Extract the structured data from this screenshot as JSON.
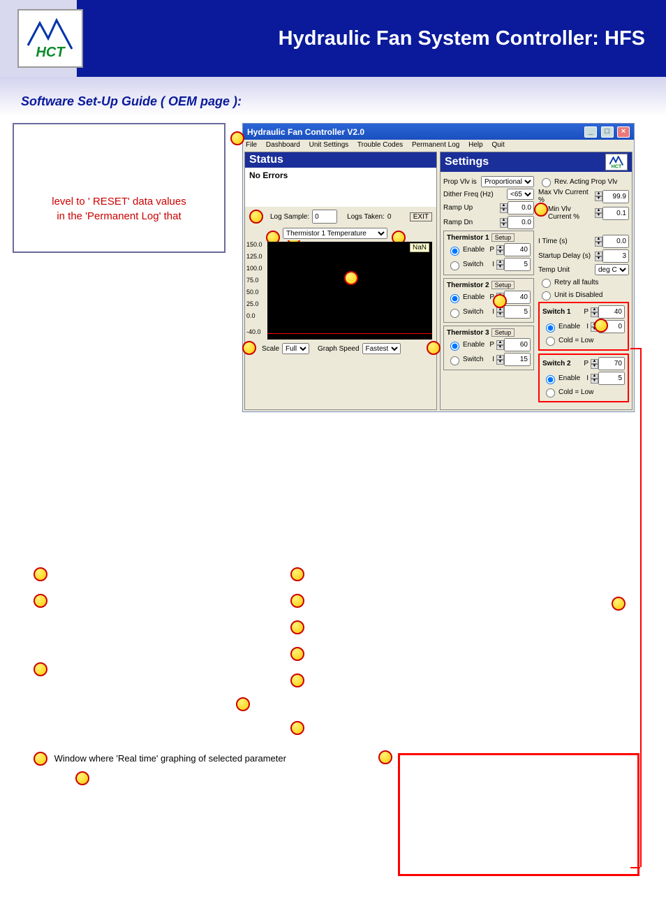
{
  "header": {
    "title": "Hydraulic Fan System Controller: HFS",
    "logo_text": "HCT"
  },
  "subheading": "Software Set-Up Guide ( OEM page ):",
  "intro_box": {
    "red_lines": [
      "level to ' RESET' data values",
      "in the 'Permanent Log' that"
    ]
  },
  "app_window": {
    "title": "Hydraulic Fan Controller V2.0",
    "menus": [
      "File",
      "Dashboard",
      "Unit Settings",
      "Trouble Codes",
      "Permanent Log",
      "Help",
      "Quit"
    ],
    "status": {
      "heading": "Status",
      "text": "No Errors",
      "log_sample_label": "Log Sample:",
      "log_sample_value": "0",
      "logs_taken_label": "Logs Taken:",
      "logs_taken_value": "0",
      "exit_label": "EXIT",
      "param_dropdown": "Thermistor 1 Temperature",
      "nan_label": "NaN",
      "y_ticks": [
        "150.0",
        "125.0",
        "100.0",
        "75.0",
        "50.0",
        "25.0",
        "0.0",
        "-40.0"
      ],
      "scale_label": "Scale",
      "scale_value": "Full",
      "graph_speed_label": "Graph Speed",
      "graph_speed_value": "Fastest"
    },
    "settings": {
      "heading": "Settings",
      "prop_vlv_label": "Prop Vlv is",
      "prop_vlv_value": "Proportional",
      "dither_label": "Dither Freq       (Hz)",
      "dither_value": "<65",
      "ramp_up_label": "Ramp Up",
      "ramp_up_value": "0.0",
      "ramp_dn_label": "Ramp Dn",
      "ramp_dn_value": "0.0",
      "rev_acting_label": "Rev. Acting Prop Vlv",
      "max_current_label": "Max Vlv Current %",
      "max_current_value": "99.9",
      "min_current_label": "Min Vlv Current %",
      "min_current_value": "0.1",
      "itime_label": "I Time (s)",
      "itime_value": "0.0",
      "startup_label": "Startup Delay (s)",
      "startup_value": "3",
      "temp_unit_label": "Temp Unit",
      "temp_unit_value": "deg C",
      "retry_label": "Retry all faults",
      "disabled_label": "Unit is Disabled",
      "thermistors": [
        {
          "name": "Thermistor 1",
          "p": "40",
          "i": "5"
        },
        {
          "name": "Thermistor 2",
          "p": "40",
          "i": "5"
        },
        {
          "name": "Thermistor 3",
          "p": "60",
          "i": "15"
        }
      ],
      "setup_label": "Setup",
      "enable_label": "Enable",
      "switch_label": "Switch",
      "p_label": "P",
      "i_label": "I",
      "switches": [
        {
          "name": "Switch 1",
          "p": "40",
          "i": "0"
        },
        {
          "name": "Switch 2",
          "p": "70",
          "i": "5"
        }
      ],
      "cold_low_label": "Cold = Low"
    }
  },
  "legend": {
    "left": [
      "",
      "",
      ""
    ],
    "right": [
      "",
      "",
      "",
      "",
      "",
      ""
    ],
    "far_right": ""
  },
  "bottom": {
    "graph_note_1": "Window where 'Real time' graphing of selected parameter",
    "graph_note_2": ""
  }
}
